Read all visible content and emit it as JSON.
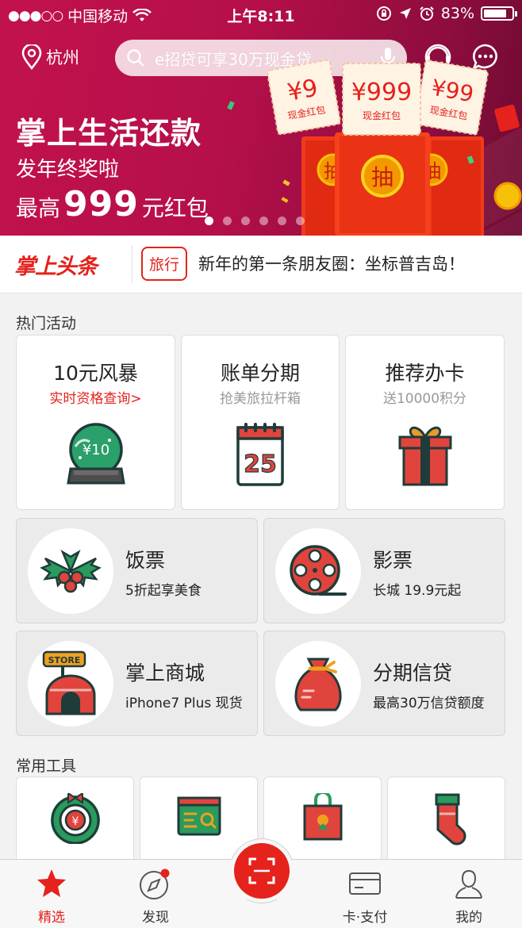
{
  "status_bar": {
    "signal": "●●●○○",
    "carrier": "中国移动",
    "time": "上午8:11",
    "battery": "83%",
    "battery_level": 0.83
  },
  "header": {
    "location": "杭州",
    "search_placeholder": "e招贷可享30万现金贷"
  },
  "banner": {
    "title": "掌上生活还款",
    "subtitle": "发年终奖啦",
    "prefix": "最高",
    "amount": "999",
    "suffix": "元红包",
    "pages": 6,
    "active_page": 0,
    "coupons": [
      {
        "amount": "¥9",
        "label": "现金红包"
      },
      {
        "amount": "¥999",
        "label": "现金红包"
      },
      {
        "amount": "¥99",
        "label": "现金红包"
      }
    ],
    "draw_label": "抽"
  },
  "headline": {
    "logo": "掌上头条",
    "tag": "旅行",
    "text": "新年的第一条朋友圈：坐标普吉岛！"
  },
  "hot_section": {
    "title": "热门活动",
    "cards": [
      {
        "title": "10元风暴",
        "sub": "实时资格查询>",
        "icon": "snow-globe-icon",
        "globe_text": "¥10"
      },
      {
        "title": "账单分期",
        "sub": "抢美旅拉杆箱",
        "icon": "calendar-icon",
        "day": "25"
      },
      {
        "title": "推荐办卡",
        "sub": "送10000积分",
        "icon": "gift-box-icon"
      }
    ],
    "services": [
      {
        "title": "饭票",
        "sub": "5折起享美食",
        "icon": "holly-icon"
      },
      {
        "title": "影票",
        "sub": "长城  19.9元起",
        "icon": "film-reel-icon"
      },
      {
        "title": "掌上商城",
        "sub": "iPhone7 Plus 现货",
        "icon": "store-icon",
        "store_text": "STORE"
      },
      {
        "title": "分期信贷",
        "sub": "最高30万信贷额度",
        "icon": "money-bag-icon"
      }
    ]
  },
  "tools_section": {
    "title": "常用工具",
    "tools": [
      {
        "icon": "wreath-icon"
      },
      {
        "icon": "card-search-icon"
      },
      {
        "icon": "shopping-bag-icon"
      },
      {
        "icon": "stocking-icon"
      }
    ]
  },
  "tabbar": {
    "tabs": [
      {
        "label": "精选",
        "icon": "star-icon"
      },
      {
        "label": "发现",
        "icon": "compass-icon"
      },
      {
        "label": "卡·支付",
        "icon": "card-icon"
      },
      {
        "label": "我的",
        "icon": "user-icon"
      }
    ],
    "scan_icon": "scan-icon"
  },
  "colors": {
    "brand_red": "#e5221c",
    "banner_bg": "#c2124d"
  }
}
